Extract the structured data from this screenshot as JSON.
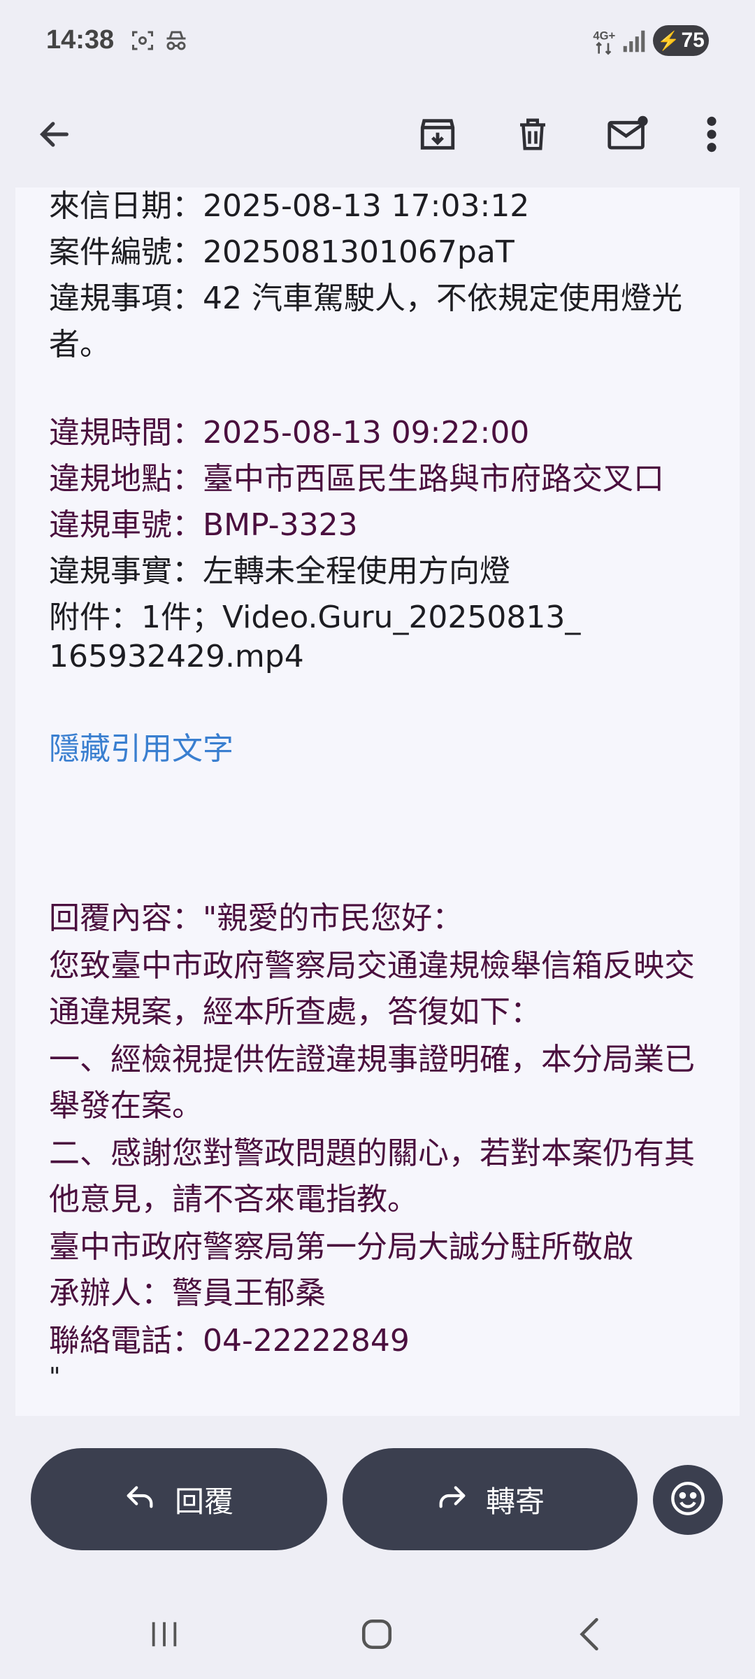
{
  "status_bar": {
    "time": "14:38",
    "network": "4G+",
    "battery": "75",
    "icons": [
      "screenshot-icon",
      "incognito-icon",
      "network-4g-icon",
      "signal-icon",
      "battery-charging-icon"
    ]
  },
  "toolbar": {
    "icons": [
      "back-arrow-icon",
      "archive-icon",
      "delete-icon",
      "mark-unread-icon",
      "more-vert-icon"
    ]
  },
  "email": {
    "received_date": "來信日期：2025-08-13 17:03:12",
    "case_number": "案件編號：2025081301067paT",
    "violation_item_line1": "違規事項：42 汽車駕駛人，不依規定使用燈光",
    "violation_item_line2": "者。",
    "violation_time": "違規時間：2025-08-13 09:22:00",
    "violation_place": "違規地點：臺中市西區民生路與市府路交叉口",
    "plate_number": "違規車號：BMP-3323",
    "violation_fact": "違規事實：左轉未全程使用方向燈",
    "attachment_line1": "附件：1件；Video.Guru_20250813_",
    "attachment_line2": "165932429.mp4",
    "hide_quoted": "隱藏引用文字",
    "reply_lines": [
      "回覆內容：\"親愛的市民您好：",
      "您致臺中市政府警察局交通違規檢舉信箱反映交",
      "通違規案，經本所查處，答復如下：",
      "一、經檢視提供佐證違規事證明確，本分局業已",
      "舉發在案。",
      "二、感謝您對警政問題的關心，若對本案仍有其",
      "他意見，請不吝來電指教。",
      "臺中市政府警察局第一分局大誠分駐所敬啟",
      "承辦人：警員王郁桑",
      "聯絡電話：04-22222849"
    ],
    "closing_quote": "\""
  },
  "actions": {
    "reply_label": "回覆",
    "forward_label": "轉寄"
  },
  "colors": {
    "background": "#eeeef5",
    "card": "#f6f6fc",
    "purple_text": "#4a0f3e",
    "link": "#3a7fd0",
    "button": "#3b3f4f"
  }
}
